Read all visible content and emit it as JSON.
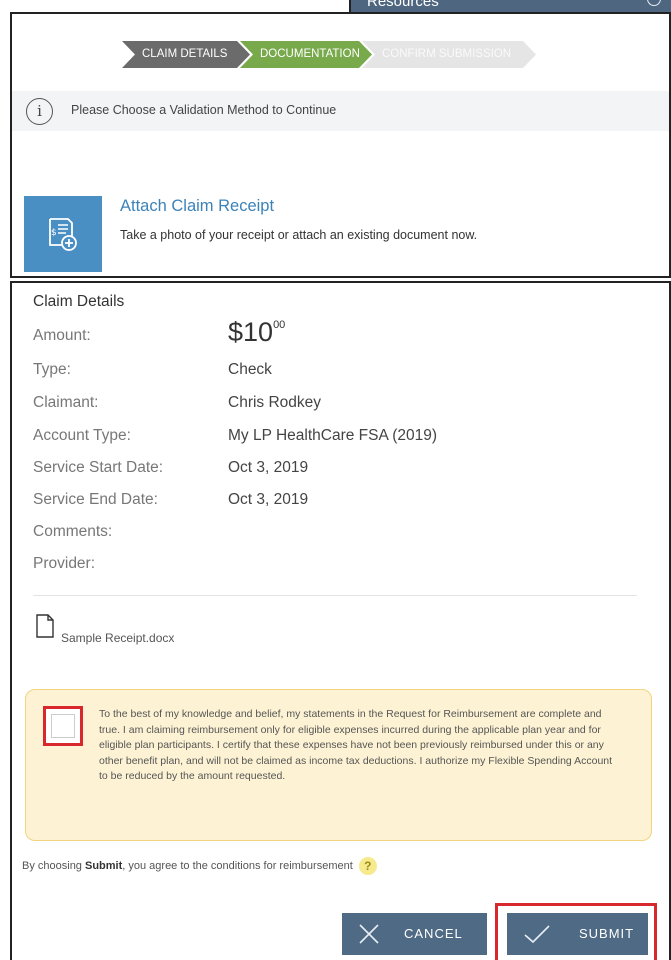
{
  "header": {
    "resources_label": "Resources"
  },
  "steps": [
    {
      "label": "CLAIM DETAILS",
      "state": "completed"
    },
    {
      "label": "DOCUMENTATION",
      "state": "active"
    },
    {
      "label": "CONFIRM SUBMISSION",
      "state": "pending"
    }
  ],
  "notice": {
    "icon": "info-icon",
    "message": "Please Choose a Validation Method to Continue"
  },
  "attach": {
    "icon": "receipt-add-icon",
    "title": "Attach Claim Receipt",
    "description": "Take a photo of your receipt or attach an existing document now."
  },
  "claim_details": {
    "section_title": "Claim Details",
    "amount_label": "Amount:",
    "amount_dollars": "$10",
    "amount_cents": "00",
    "rows": [
      {
        "label": "Type:",
        "value": "Check"
      },
      {
        "label": "Claimant:",
        "value": "Chris Rodkey"
      },
      {
        "label": "Account Type:",
        "value": "My LP HealthCare FSA (2019)"
      },
      {
        "label": "Service Start Date:",
        "value": "Oct 3, 2019"
      },
      {
        "label": "Service End Date:",
        "value": "Oct 3, 2019"
      },
      {
        "label": "Comments:",
        "value": ""
      },
      {
        "label": "Provider:",
        "value": ""
      }
    ]
  },
  "attachment": {
    "icon": "document-icon",
    "file_name": "Sample Receipt.docx"
  },
  "certification": {
    "checked": false,
    "text": "To the best of my knowledge and belief, my statements in the Request for Reimbursement are complete and true. I am claiming reimbursement only for eligible expenses incurred during the applicable plan year and for eligible plan participants. I certify that these expenses have not been previously reimbursed under this or any other benefit plan, and will not be claimed as income tax deductions. I authorize my Flexible Spending Account to be reduced by the amount requested."
  },
  "agreement": {
    "prefix": "By choosing ",
    "bold": "Submit",
    "suffix": ", you agree to the conditions for reimbursement",
    "help_icon": "?"
  },
  "actions": {
    "cancel_label": "CANCEL",
    "submit_label": "SUBMIT"
  },
  "colors": {
    "step_completed": "#6b6b6b",
    "step_active": "#78a94a",
    "step_pending": "#e5e5e5",
    "button": "#4f6a84",
    "highlight": "#d9272e",
    "link": "#3b82b8"
  }
}
